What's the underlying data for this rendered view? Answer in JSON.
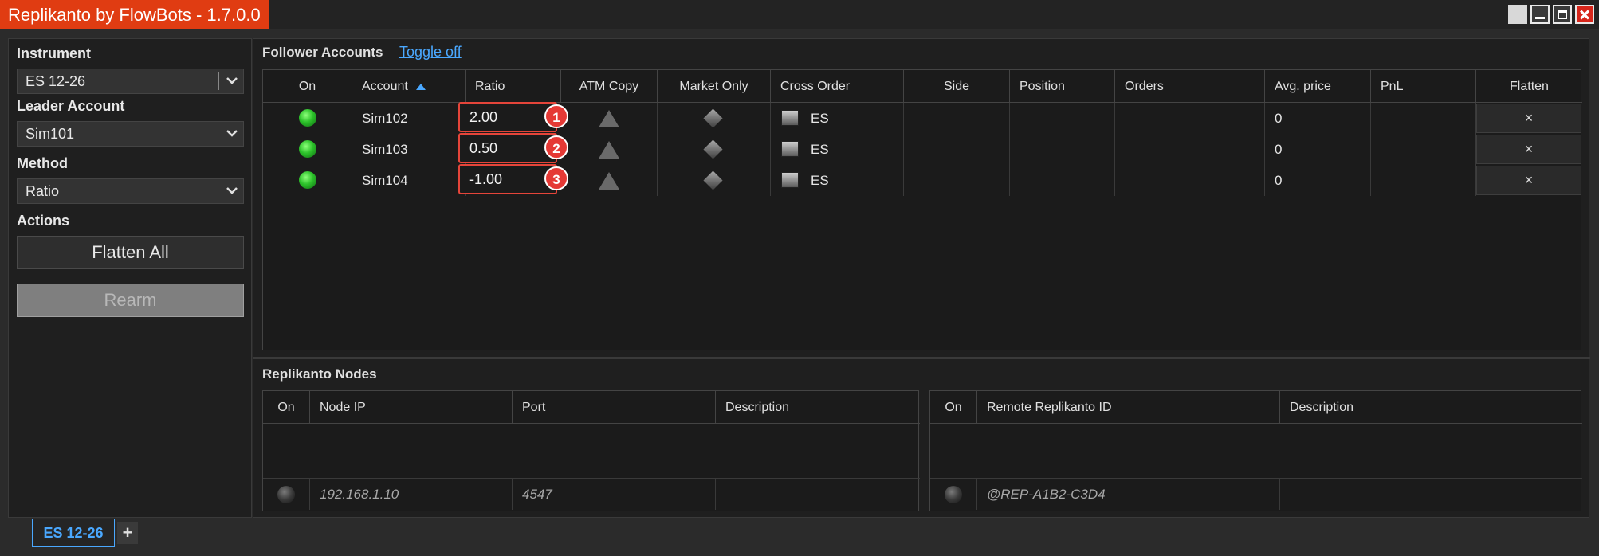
{
  "window": {
    "title": "Replikanto by FlowBots - 1.7.0.0"
  },
  "left": {
    "instrument_label": "Instrument",
    "instrument_value": "ES 12-26",
    "leader_label": "Leader Account",
    "leader_value": "Sim101",
    "method_label": "Method",
    "method_value": "Ratio",
    "actions_label": "Actions",
    "flatten_all": "Flatten All",
    "rearm": "Rearm"
  },
  "followers": {
    "title": "Follower Accounts",
    "toggle": "Toggle off",
    "columns": [
      "On",
      "Account",
      "Ratio",
      "ATM Copy",
      "Market Only",
      "Cross Order",
      "Side",
      "Position",
      "Orders",
      "Avg. price",
      "PnL",
      "Flatten"
    ],
    "rows": [
      {
        "account": "Sim102",
        "ratio": "2.00",
        "badge": "1",
        "cross": "ES",
        "avg": "0",
        "flatten": "×"
      },
      {
        "account": "Sim103",
        "ratio": "0.50",
        "badge": "2",
        "cross": "ES",
        "avg": "0",
        "flatten": "×"
      },
      {
        "account": "Sim104",
        "ratio": "-1.00",
        "badge": "3",
        "cross": "ES",
        "avg": "0",
        "flatten": "×"
      }
    ]
  },
  "nodes": {
    "title": "Replikanto Nodes",
    "left_columns": [
      "On",
      "Node IP",
      "Port",
      "Description"
    ],
    "left_row": {
      "ip": "192.168.1.10",
      "port": "4547"
    },
    "right_columns": [
      "On",
      "Remote Replikanto ID",
      "Description"
    ],
    "right_row": {
      "id": "@REP-A1B2-C3D4"
    }
  },
  "tabs": {
    "active": "ES 12-26",
    "add": "+"
  }
}
